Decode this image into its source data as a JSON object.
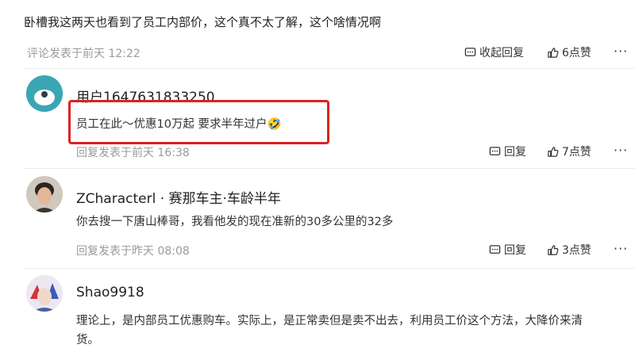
{
  "top_comment": {
    "text": "卧槽我这两天也看到了员工内部价，这个真不太了解，这个啥情况啊",
    "meta": "评论发表于前天 12:22",
    "collapse_reply_label": "收起回复",
    "like_label": "6点赞",
    "more_label": "···"
  },
  "replies": [
    {
      "username": "用户1647631833250",
      "content": "员工在此～优惠10万起 要求半年过户🤣",
      "meta": "回复发表于前天 16:38",
      "reply_label": "回复",
      "like_label": "7点赞",
      "more_label": "···"
    },
    {
      "username": "ZCharacterl · 赛那车主·车龄半年",
      "content": "你去搜一下唐山棒哥，我看他发的现在准新的30多公里的32多",
      "meta": "回复发表于昨天 08:08",
      "reply_label": "回复",
      "like_label": "3点赞",
      "more_label": "···"
    },
    {
      "username": "Shao9918",
      "content_line1": "理论上，是内部员工优惠购车。实际上，是正常卖但是卖不出去，利用员工价这个方法，大降价来清",
      "content_line2": "货。"
    }
  ],
  "colors": {
    "highlight_border": "#d9231f",
    "meta_text": "#9a9a9a",
    "avatar1_bg": "#3aa6b4"
  },
  "icons": [
    "reply-icon",
    "like-icon",
    "more-icon"
  ]
}
